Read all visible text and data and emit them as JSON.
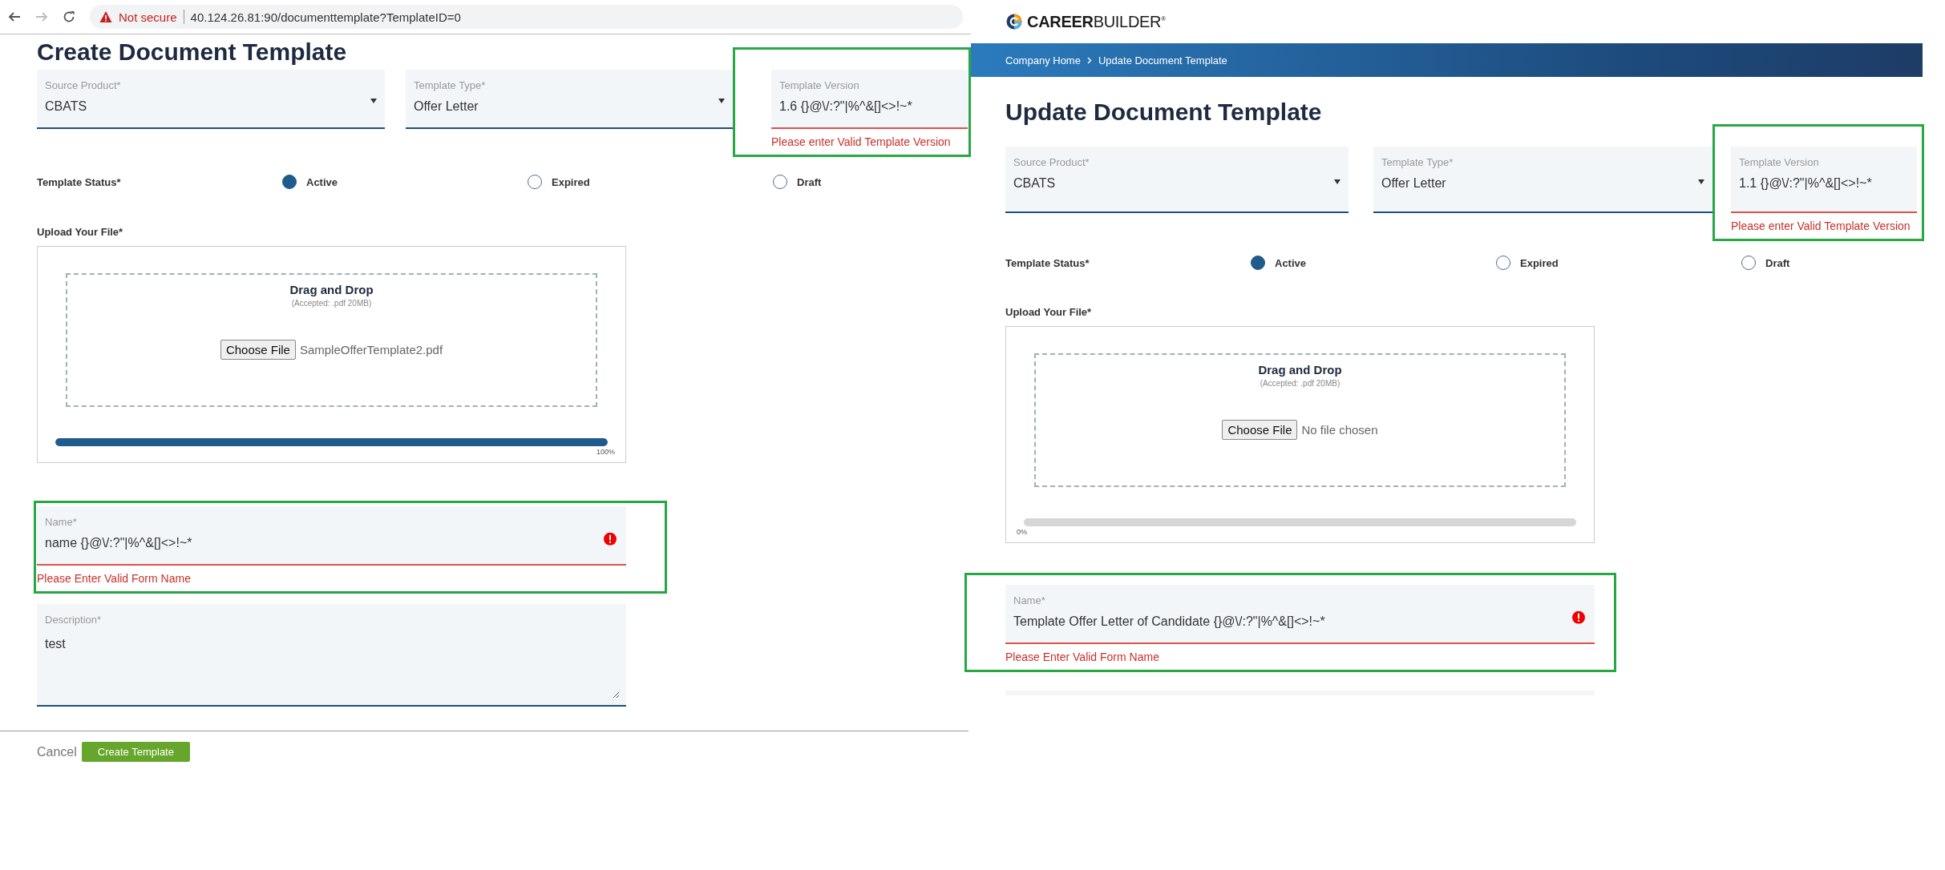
{
  "panels": [
    {
      "browser_bar": {
        "security": "Not secure",
        "url": "40.124.26.81:90/documenttemplate?TemplateID=0"
      },
      "title": "Create Document Template",
      "fields": [
        {
          "kind": "select",
          "label": "Source Product*",
          "value": "CBATS",
          "highlighted": false
        },
        {
          "kind": "select",
          "label": "Template Type*",
          "value": "Offer Letter",
          "highlighted": false
        },
        {
          "kind": "text",
          "label": "Template Version",
          "value": "1.6 {}@\\/:?\"|%^&[]<>!~*",
          "error": "Please enter Valid Template Version",
          "highlighted": true
        }
      ],
      "status": {
        "label": "Template Status*",
        "options": [
          {
            "label": "Active",
            "selected": true
          },
          {
            "label": "Expired",
            "selected": false
          },
          {
            "label": "Draft",
            "selected": false
          }
        ]
      },
      "upload": {
        "label": "Upload Your File*",
        "heading": "Drag and Drop",
        "accepted": "(Accepted: .pdf 20MB)",
        "button": "Choose File",
        "file_name": "SampleOfferTemplate2.pdf",
        "level": 1,
        "percent": "100%"
      },
      "name_field": {
        "label": "Name*",
        "value": "name {}@\\/:?\"|%^&[]<>!~*",
        "error": "Please Enter Valid Form Name",
        "alert_icon": true,
        "highlighted": true
      },
      "description": {
        "label": "Description*",
        "value": "test"
      },
      "actions": {
        "cancel": "Cancel",
        "submit": "Create Template"
      }
    },
    {
      "header": {
        "logo": "**CAREER**BUILDER$^{®}$",
        "breadcrumb": [
          "Company Home",
          "Update Document Template"
        ]
      },
      "title": "Update Document Template",
      "fields": [
        {
          "kind": "select",
          "label": "Source Product*",
          "value": "CBATS",
          "highlighted": false
        },
        {
          "kind": "select",
          "label": "Template Type*",
          "value": "Offer Letter",
          "highlighted": false
        },
        {
          "kind": "text",
          "label": "Template Version",
          "value": "1.1 {}@\\/:?\"|%^&[]<>!~*",
          "error": "Please enter Valid Template Version",
          "highlighted": true
        }
      ],
      "status": {
        "label": "Template Status*",
        "options": [
          {
            "label": "Active",
            "selected": true
          },
          {
            "label": "Expired",
            "selected": false
          },
          {
            "label": "Draft",
            "selected": false
          }
        ]
      },
      "upload": {
        "label": "Upload Your File*",
        "heading": "Drag and Drop",
        "accepted": "(Accepted: .pdf 20MB)",
        "button": "Choose File",
        "file_name": "No file chosen",
        "level": 0,
        "percent": "0%"
      },
      "name_field": {
        "label": "Name*",
        "value": "Template Offer Letter of Candidate {}@\\/:?\"|%^&[]<>!~*",
        "error": "Please Enter Valid Form Name",
        "alert_icon": true,
        "highlighted": true
      }
    }
  ]
}
